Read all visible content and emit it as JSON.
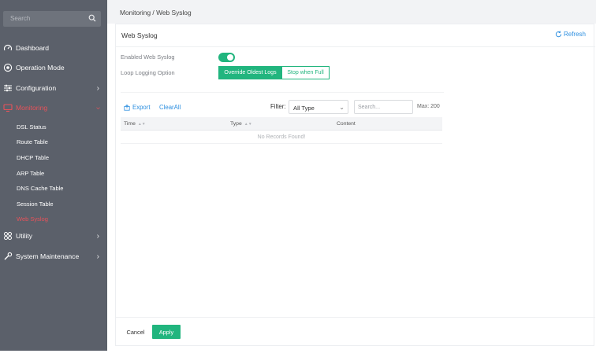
{
  "sidebar": {
    "search_placeholder": "Search",
    "items": [
      {
        "label": "Dashboard",
        "icon": "gauge-icon"
      },
      {
        "label": "Operation Mode",
        "icon": "target-icon"
      },
      {
        "label": "Configuration",
        "icon": "sliders-icon"
      },
      {
        "label": "Monitoring",
        "icon": "monitor-icon"
      },
      {
        "label": "Utility",
        "icon": "grid-icon"
      },
      {
        "label": "System Maintenance",
        "icon": "wrench-icon"
      }
    ],
    "sub_items": [
      {
        "label": "DSL Status"
      },
      {
        "label": "Route Table"
      },
      {
        "label": "DHCP Table"
      },
      {
        "label": "ARP Table"
      },
      {
        "label": "DNS Cache Table"
      },
      {
        "label": "Session Table"
      },
      {
        "label": "Web Syslog"
      }
    ],
    "active_accent": "#e8525a"
  },
  "header": {
    "breadcrumb": "Monitoring / Web Syslog"
  },
  "panel": {
    "title": "Web Syslog",
    "refresh_label": "Refresh",
    "enabled_label": "Enabled Web Syslog",
    "enabled": true,
    "loop_label": "Loop Logging Option",
    "loop_options": [
      "Override Oldest Logs",
      "Stop when Full"
    ],
    "loop_selected": "Override Oldest Logs",
    "export_label": "Export",
    "clear_label": "ClearAll",
    "filter_label": "Filter:",
    "filter_value": "All Type",
    "search_placeholder": "Search...",
    "max_label": "Max: 200",
    "columns": [
      "Time",
      "Type",
      "Content"
    ],
    "empty_text": "No Records Found!",
    "cancel_label": "Cancel",
    "apply_label": "Apply"
  },
  "colors": {
    "accent": "#21b57e",
    "link": "#2d8fe0",
    "sidebar_bg": "#5b606a"
  }
}
